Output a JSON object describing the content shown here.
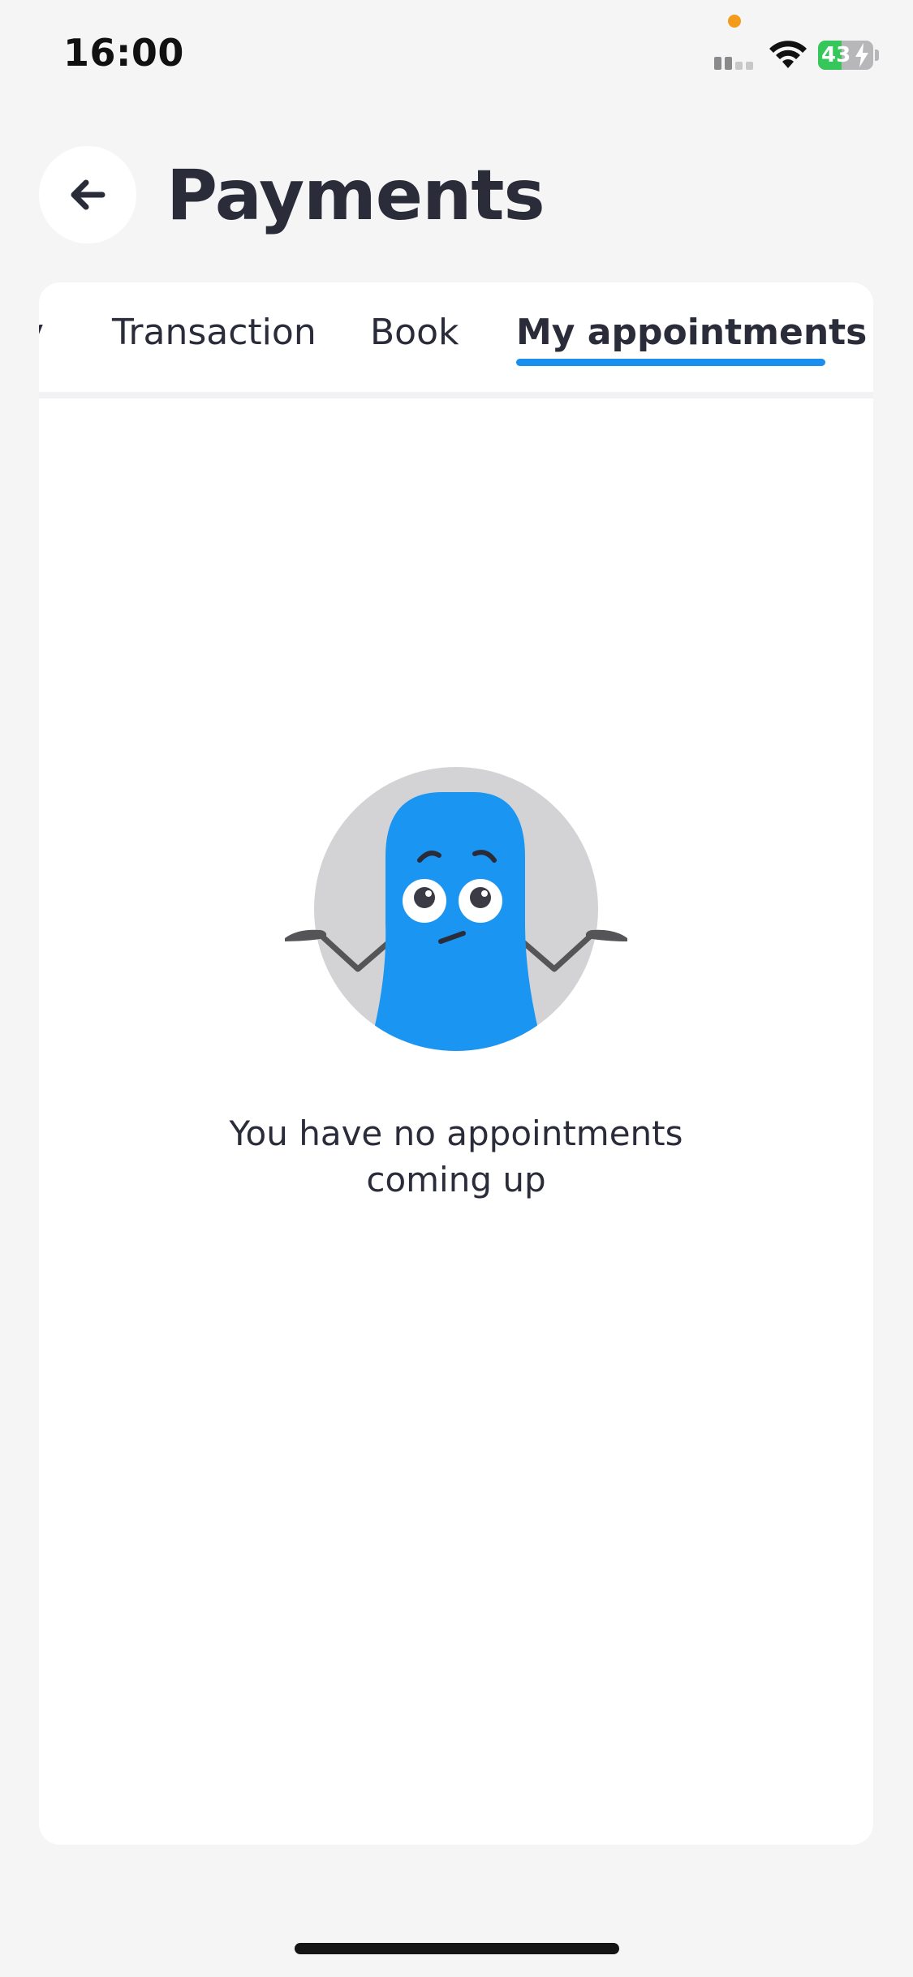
{
  "status_bar": {
    "time": "16:00",
    "battery": "43",
    "battery_level": 0.43,
    "icons": [
      "signal-icon",
      "wifi-icon",
      "battery-icon"
    ]
  },
  "header": {
    "title": "Payments",
    "back_icon": "arrow-left-icon"
  },
  "tabs": {
    "items": [
      {
        "label": "y",
        "active": false
      },
      {
        "label": "Transaction",
        "active": false
      },
      {
        "label": "Book",
        "active": false
      },
      {
        "label": "My appointments",
        "active": true
      }
    ]
  },
  "empty_state": {
    "message": "You have no appointments coming up",
    "illustration": "shrugging-character-illustration"
  },
  "colors": {
    "accent": "#1b8ff0",
    "background": "#f5f5f6",
    "text": "#2b2c3a",
    "battery_green": "#35c759"
  }
}
